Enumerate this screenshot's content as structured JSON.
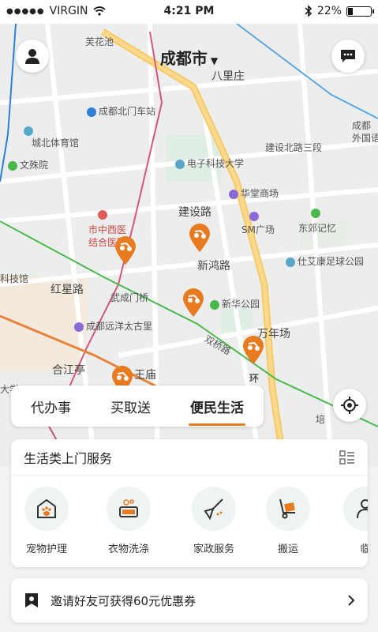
{
  "status": {
    "carrier": "VIRGIN",
    "time": "4:21 PM",
    "battery": "22%",
    "battery_level": 0.22
  },
  "header": {
    "city": "成都市"
  },
  "map": {
    "labels": {
      "l1": "芙花池",
      "l2": "八里庄",
      "l3": "成都北门车站",
      "l4": "城北体育馆",
      "l5": "成都",
      "l6": "外国语",
      "l7": "建设北路三段",
      "l8": "文殊院",
      "l9": "电子科技大学",
      "l10": "华堂商场",
      "l11": "建设路",
      "l12": "市中西医",
      "l13": "结合医院",
      "l14": "SM广场",
      "l15": "东郊记忆",
      "l16": "新鸿路",
      "l17": "仕艾康足球公园",
      "l18": "科技馆",
      "l19": "红星路",
      "l20": "武成门桥",
      "l21": "新华公园",
      "l22": "成都远洋太古里",
      "l23": "万年场",
      "l24": "双桥路",
      "l25": "合江亭",
      "l26": "王庙",
      "l27": "大学",
      "l28": "培",
      "l29": "环"
    }
  },
  "tabs": {
    "t1": "代办事",
    "t2": "买取送",
    "t3": "便民生活"
  },
  "services": {
    "title": "生活类上门服务",
    "items": {
      "s1": "宠物护理",
      "s2": "衣物洗涤",
      "s3": "家政服务",
      "s4": "搬运",
      "s5": "临"
    }
  },
  "invite": {
    "text": "邀请好友可获得60元优惠券"
  },
  "colors": {
    "accent": "#e87a1f",
    "road_major": "#f7c96a"
  }
}
